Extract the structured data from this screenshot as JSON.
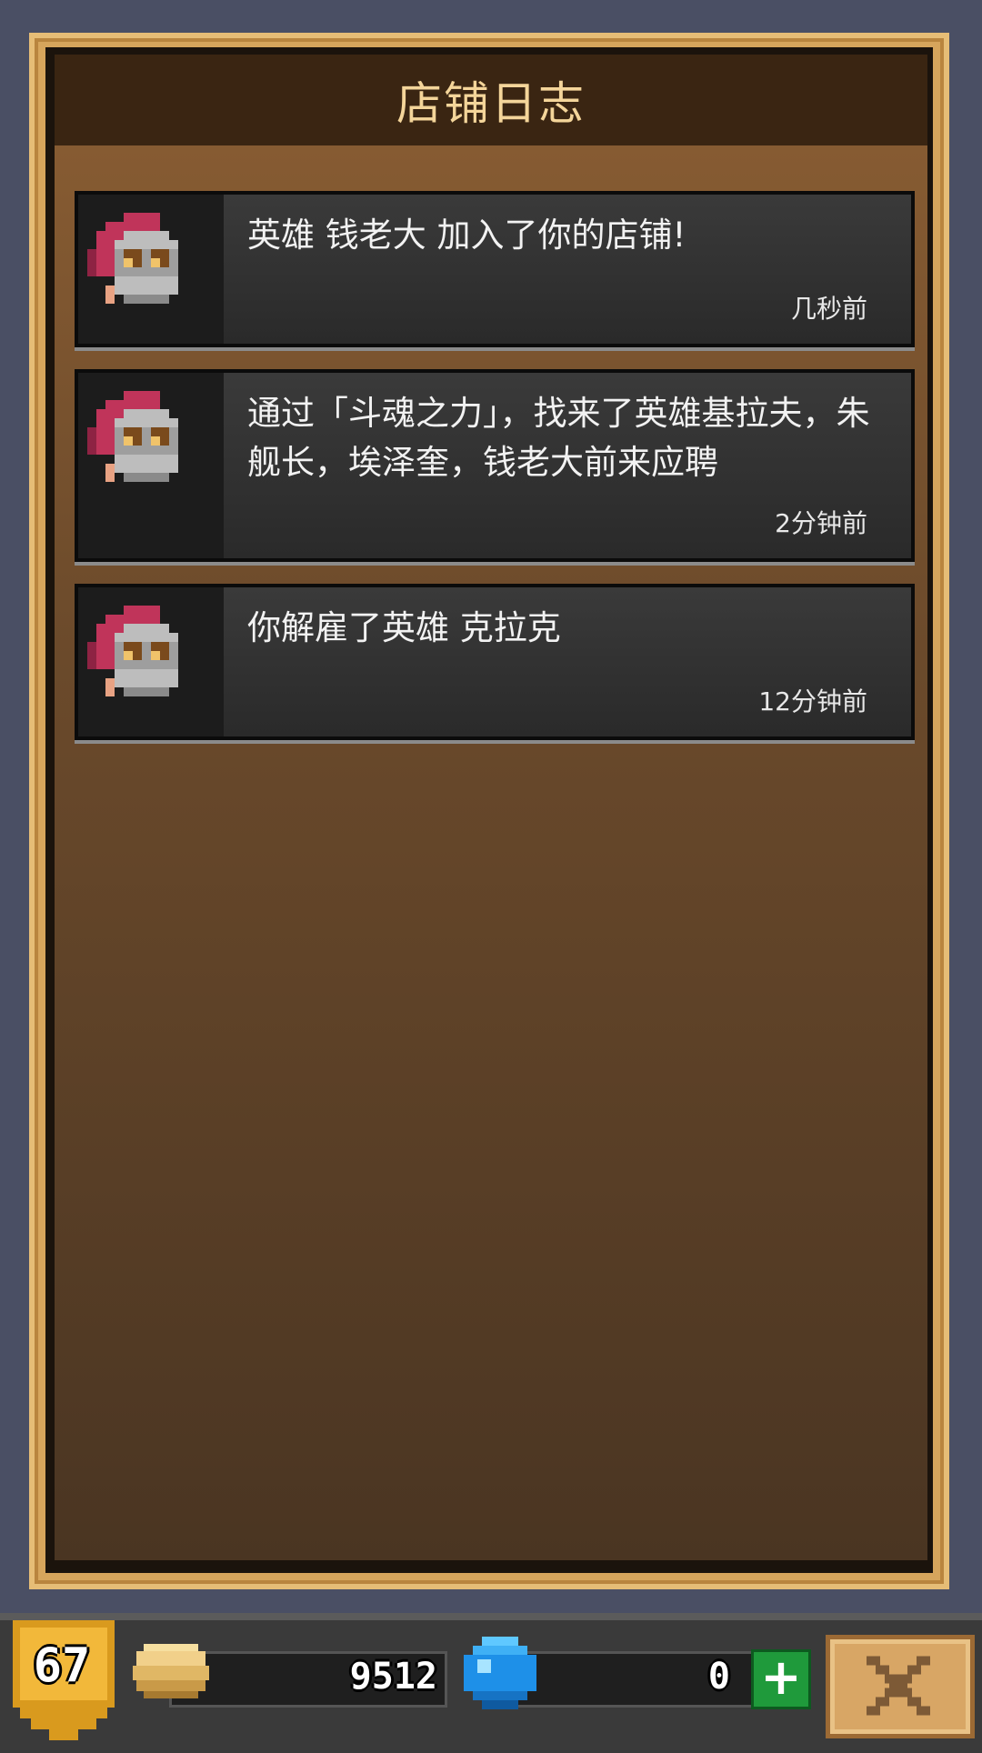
{
  "panel": {
    "title": "店铺日志"
  },
  "logs": [
    {
      "message": "英雄 钱老大 加入了你的店铺!",
      "time": "几秒前",
      "avatar": "knight-helmet-icon"
    },
    {
      "message": "通过「斗魂之力」，找来了英雄基拉夫，朱舰长，埃泽奎，钱老大前来应聘",
      "time": "2分钟前",
      "avatar": "knight-helmet-icon"
    },
    {
      "message": "你解雇了英雄 克拉克",
      "time": "12分钟前",
      "avatar": "knight-helmet-icon"
    }
  ],
  "status": {
    "level": "67",
    "gold": "9512",
    "gems": "0"
  },
  "colors": {
    "panel_border": "#d6a55c",
    "header_bg": "#3a2512",
    "title_text": "#f4d59a",
    "card_bg": "#2a2a2a",
    "plus_green": "#1f9a3b"
  }
}
